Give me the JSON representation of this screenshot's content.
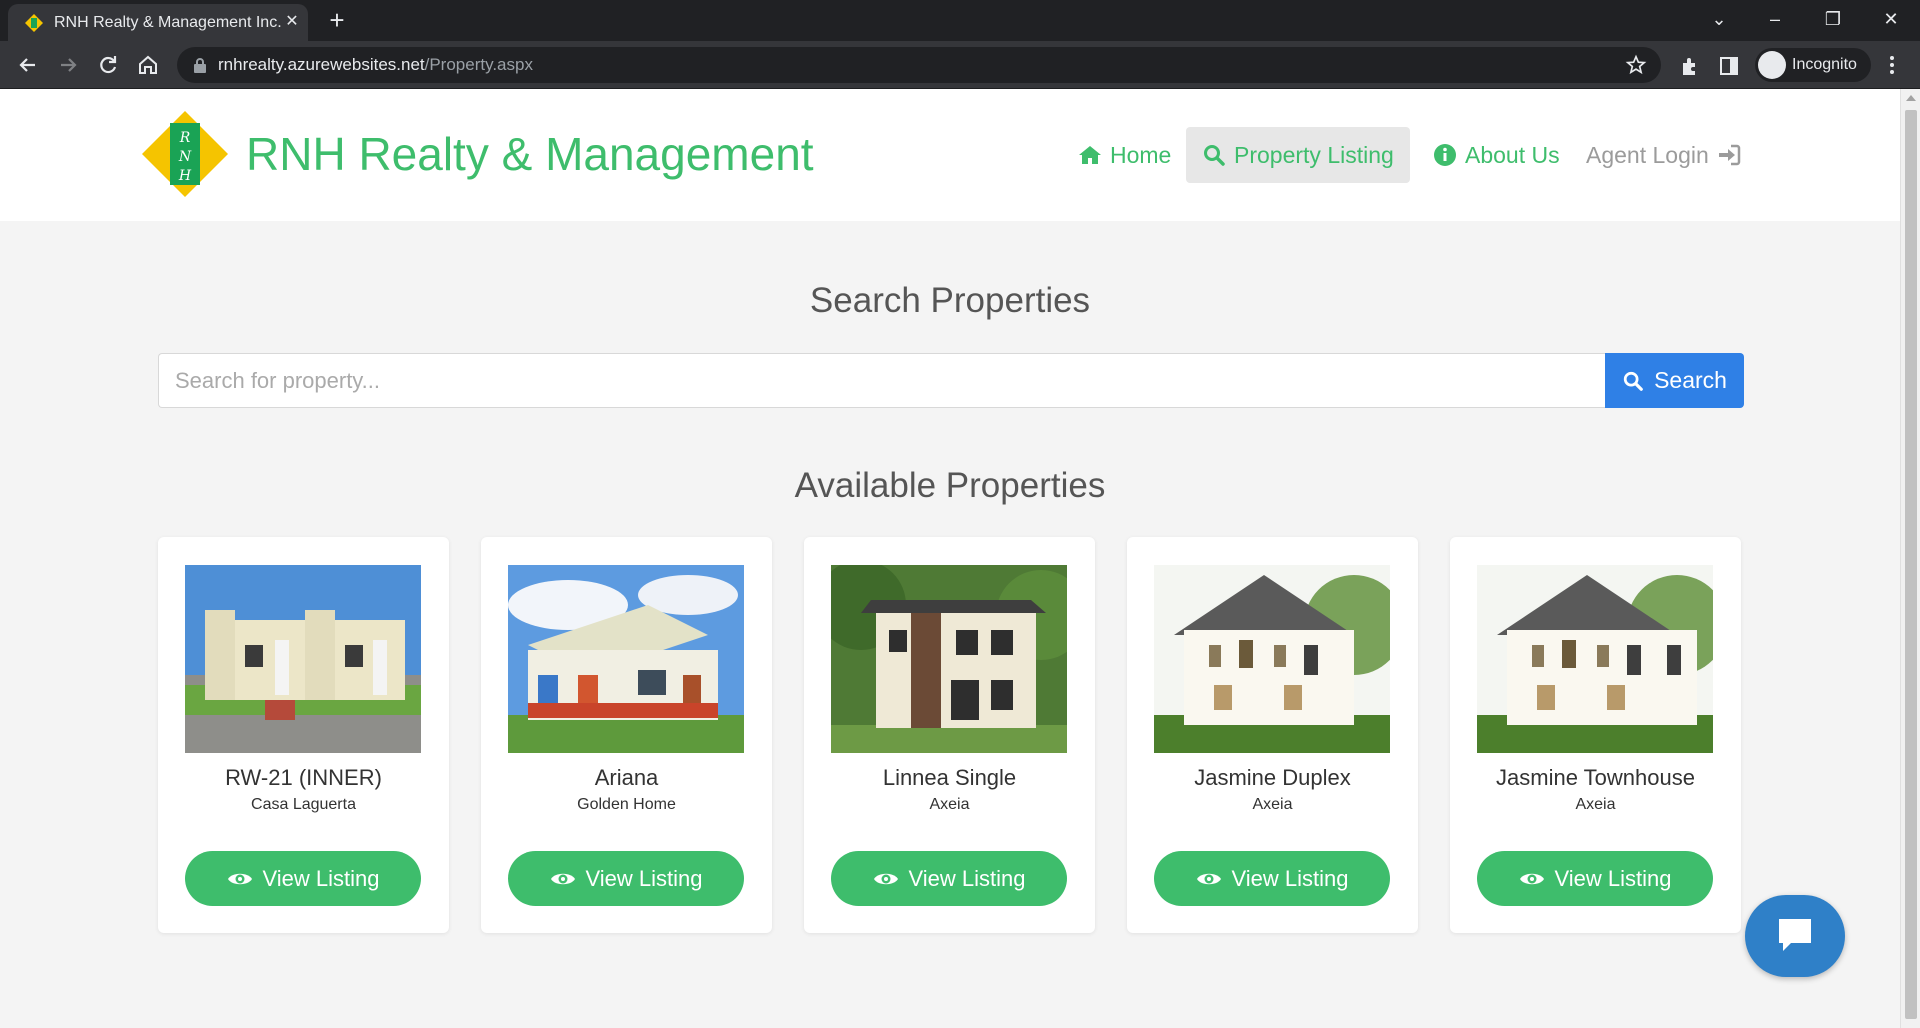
{
  "browser": {
    "tab_title": "RNH Realty & Management Inc.",
    "url_host": "rnhrealty.azurewebsites.net",
    "url_path": "/Property.aspx",
    "profile_label": "Incognito"
  },
  "header": {
    "brand": "RNH Realty & Management",
    "logo_letters": [
      "R",
      "N",
      "H"
    ],
    "nav": [
      {
        "label": "Home",
        "icon": "home-icon"
      },
      {
        "label": "Property Listing",
        "icon": "search-icon"
      },
      {
        "label": "About Us",
        "icon": "info-icon"
      },
      {
        "label": "Agent Login",
        "icon": "sign-in-icon"
      }
    ]
  },
  "search": {
    "heading": "Search Properties",
    "placeholder": "Search for property...",
    "button_label": "Search"
  },
  "listing": {
    "heading": "Available Properties",
    "button_label": "View Listing",
    "properties": [
      {
        "name": "RW-21 (INNER)",
        "developer": "Casa Laguerta"
      },
      {
        "name": "Ariana",
        "developer": "Golden Home"
      },
      {
        "name": "Linnea Single",
        "developer": "Axeia"
      },
      {
        "name": "Jasmine Duplex",
        "developer": "Axeia"
      },
      {
        "name": "Jasmine Townhouse",
        "developer": "Axeia"
      }
    ]
  },
  "colors": {
    "brand_green": "#3ebd6c",
    "search_blue": "#2f80e6",
    "chat_blue": "#2f80c8"
  }
}
